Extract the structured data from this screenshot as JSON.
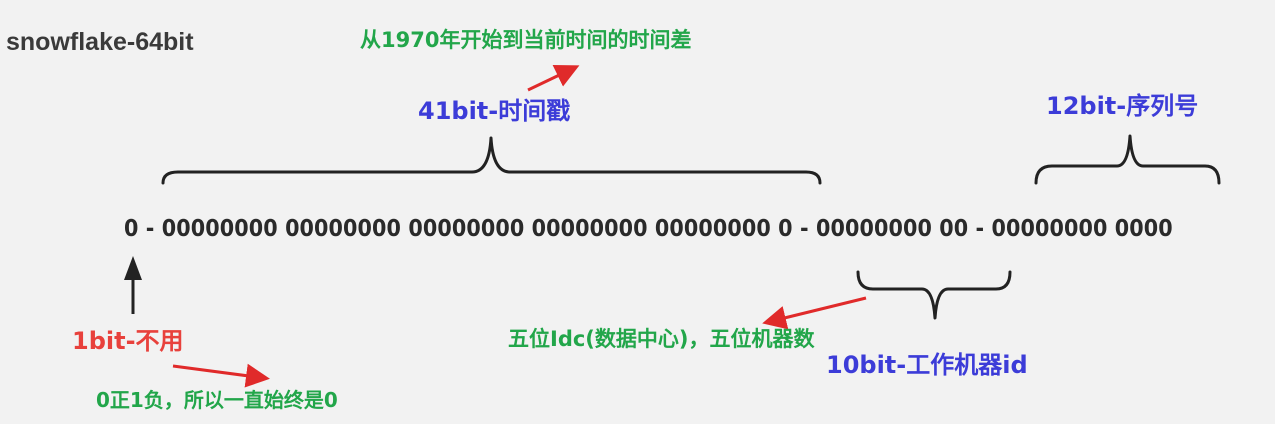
{
  "diagram": {
    "title": "snowflake-64bit",
    "bit_string": "0 - 00000000 00000000 00000000 00000000 00000000 0 - 00000000 00 - 00000000 0000",
    "timestamp": {
      "label": "41bit-时间戳",
      "note": "从1970年开始到当前时间的时间差"
    },
    "sequence": {
      "label": "12bit-序列号"
    },
    "sign": {
      "label": "1bit-不用",
      "note": "0正1负，所以一直始终是0"
    },
    "machine": {
      "label": "10bit-工作机器id",
      "note": "五位Idc(数据中心)，五位机器数"
    },
    "colors": {
      "title": "#3a3a3a",
      "note_green": "#22a64a",
      "label_blue": "#3c3cd8",
      "label_red": "#e8413c",
      "arrow_red": "#e02a2a",
      "brace": "#222222"
    }
  }
}
